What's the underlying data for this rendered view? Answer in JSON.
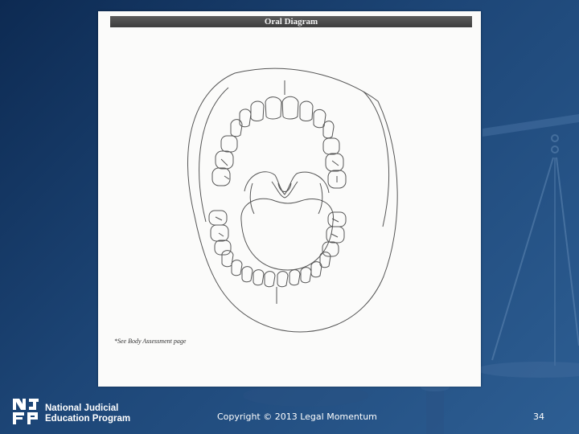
{
  "slide": {
    "diagram_title": "Oral Diagram",
    "footnote": "*See Body Assessment page",
    "logo": {
      "mark_icon": "njep-logo-icon",
      "line1": "National Judicial",
      "line2": "Education Program"
    },
    "copyright": "Copyright © 2013 Legal Momentum",
    "page_number": "34",
    "watermark_icon": "scales-of-justice-icon"
  },
  "colors": {
    "background_dark": "#0d2a52",
    "background_light": "#2d5e93",
    "page": "#fbfbfa",
    "title_bar": "#4a4a4a",
    "line_art": "#555555",
    "footer_text": "#ffffff"
  }
}
